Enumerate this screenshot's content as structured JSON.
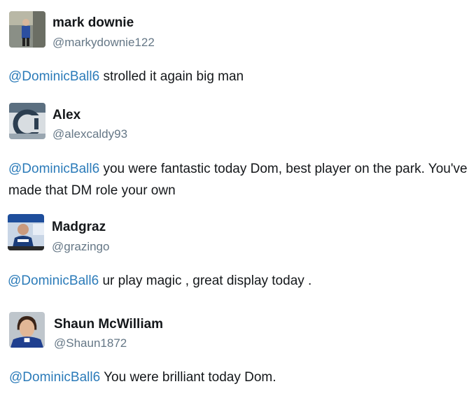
{
  "tweets": [
    {
      "name": "mark downie",
      "handle": "@markydownie122",
      "mention": "@DominicBall6",
      "text": " strolled it again big man",
      "avatar_icon": "person-standing-icon"
    },
    {
      "name": "Alex",
      "handle": "@alexcaldy93",
      "mention": "@DominicBall6",
      "text": " you were fantastic today Dom, best player on the park. You've made that DM role your own",
      "avatar_icon": "sign-letters-icon"
    },
    {
      "name": "Madgraz",
      "handle": "@grazingo",
      "mention": "@DominicBall6",
      "text": " ur play magic , great display today .",
      "avatar_icon": "press-conference-icon"
    },
    {
      "name": "Shaun McWilliam",
      "handle": "@Shaun1872",
      "mention": "@DominicBall6",
      "text": " You were brilliant today Dom.",
      "avatar_icon": "footballer-portrait-icon"
    }
  ],
  "colors": {
    "mention": "#2b7bb9",
    "name": "#14171a",
    "handle": "#657786"
  }
}
